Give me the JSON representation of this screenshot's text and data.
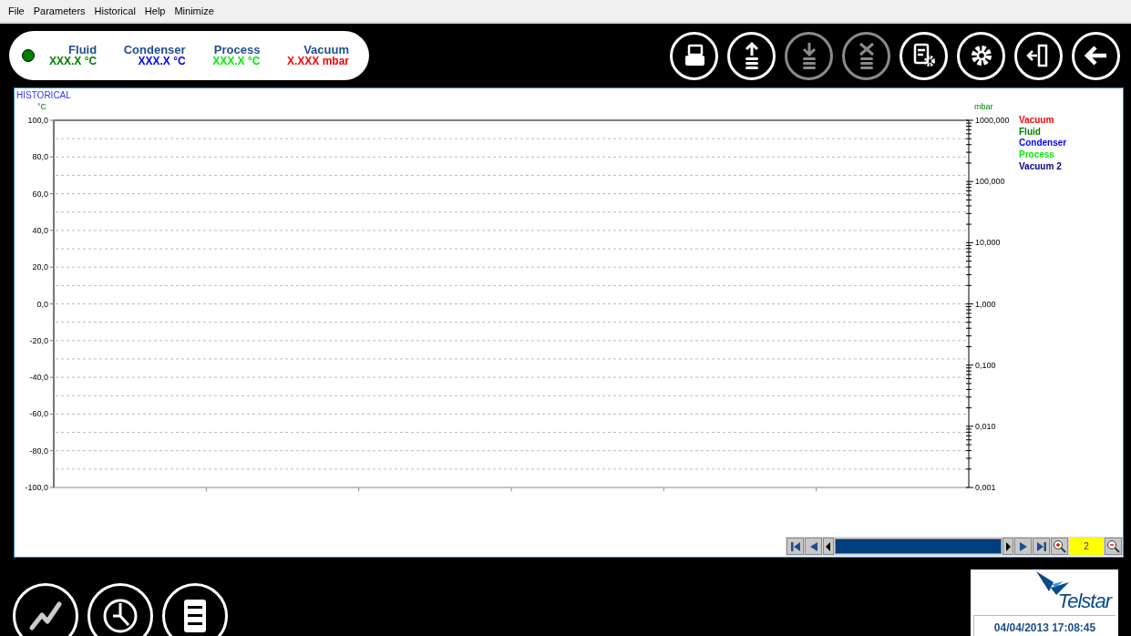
{
  "menu": [
    "File",
    "Parameters",
    "Historical",
    "Help",
    "Minimize"
  ],
  "status": {
    "on": true,
    "readings": [
      {
        "label": "Fluid",
        "value": "XXX.X °C",
        "color": "#008000"
      },
      {
        "label": "Condenser",
        "value": "XXX.X °C",
        "color": "#0000ff"
      },
      {
        "label": "Process",
        "value": "XXX.X °C",
        "color": "#00ee00"
      },
      {
        "label": "Vacuum",
        "value": "X.XXX mbar",
        "color": "#ff0000"
      }
    ]
  },
  "toolbar": [
    {
      "kind": "print",
      "disabled": false
    },
    {
      "kind": "upload",
      "disabled": false
    },
    {
      "kind": "download",
      "disabled": true
    },
    {
      "kind": "delete",
      "disabled": true
    },
    {
      "kind": "report-settings",
      "disabled": false
    },
    {
      "kind": "settings",
      "disabled": false
    },
    {
      "kind": "exit",
      "disabled": false
    },
    {
      "kind": "back",
      "disabled": false
    }
  ],
  "chart": {
    "title": "HISTORICAL",
    "left_unit": "°C",
    "right_unit": "mbar",
    "left_ticks": [
      "100,0",
      "80,0",
      "60,0",
      "40,0",
      "20,0",
      "0,0",
      "-20,0",
      "-40,0",
      "-60,0",
      "-80,0",
      "-100,0"
    ],
    "right_ticks": [
      "1000,000",
      "100,000",
      "10,000",
      "1,000",
      "0,100",
      "0,010",
      "0,001"
    ],
    "legend": [
      {
        "label": "Vacuum",
        "color": "#ff0000"
      },
      {
        "label": "Fluid",
        "color": "#008000"
      },
      {
        "label": "Condenser",
        "color": "#0000ff"
      },
      {
        "label": "Process",
        "color": "#00ee00"
      },
      {
        "label": "Vacuum 2",
        "color": "#000080"
      }
    ]
  },
  "navigator": {
    "zoom": "2"
  },
  "bottom_buttons": [
    {
      "kind": "trend"
    },
    {
      "kind": "clock"
    },
    {
      "kind": "list"
    }
  ],
  "logo": {
    "text": "Telstar"
  },
  "datetime": "04/04/2013 17:08:45"
}
